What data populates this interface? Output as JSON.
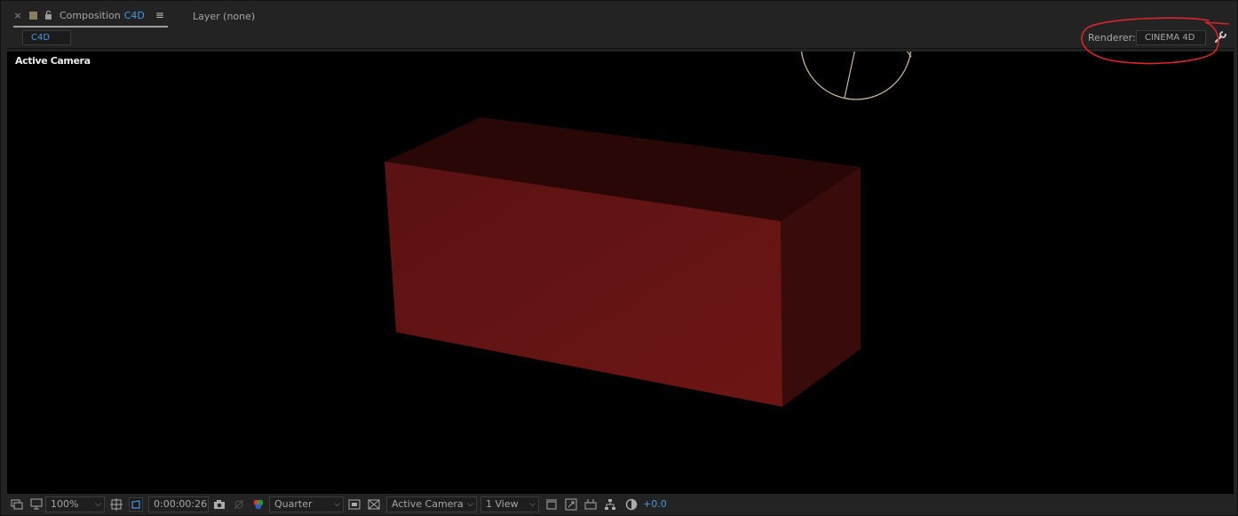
{
  "panel": {
    "tabs": [
      {
        "label": "Composition",
        "name": "C4D",
        "active": true
      },
      {
        "label": "Layer (none)",
        "active": false
      }
    ],
    "close_glyph": "×",
    "menu_glyph": "≡"
  },
  "subrow": {
    "comp_chip": "C4D",
    "renderer_label": "Renderer:",
    "renderer_value": "CINEMA 4D"
  },
  "viewer": {
    "view_label": "Active Camera",
    "background": "#000000",
    "object_color": "#6b1414"
  },
  "toolbar": {
    "zoom": "100%",
    "timecode": "0:00:00:26",
    "resolution": "Quarter",
    "camera": "Active Camera",
    "views": "1 View",
    "exposure": "+0.0"
  },
  "colors": {
    "accent": "#4a98e8",
    "annotation": "#d9262c"
  }
}
